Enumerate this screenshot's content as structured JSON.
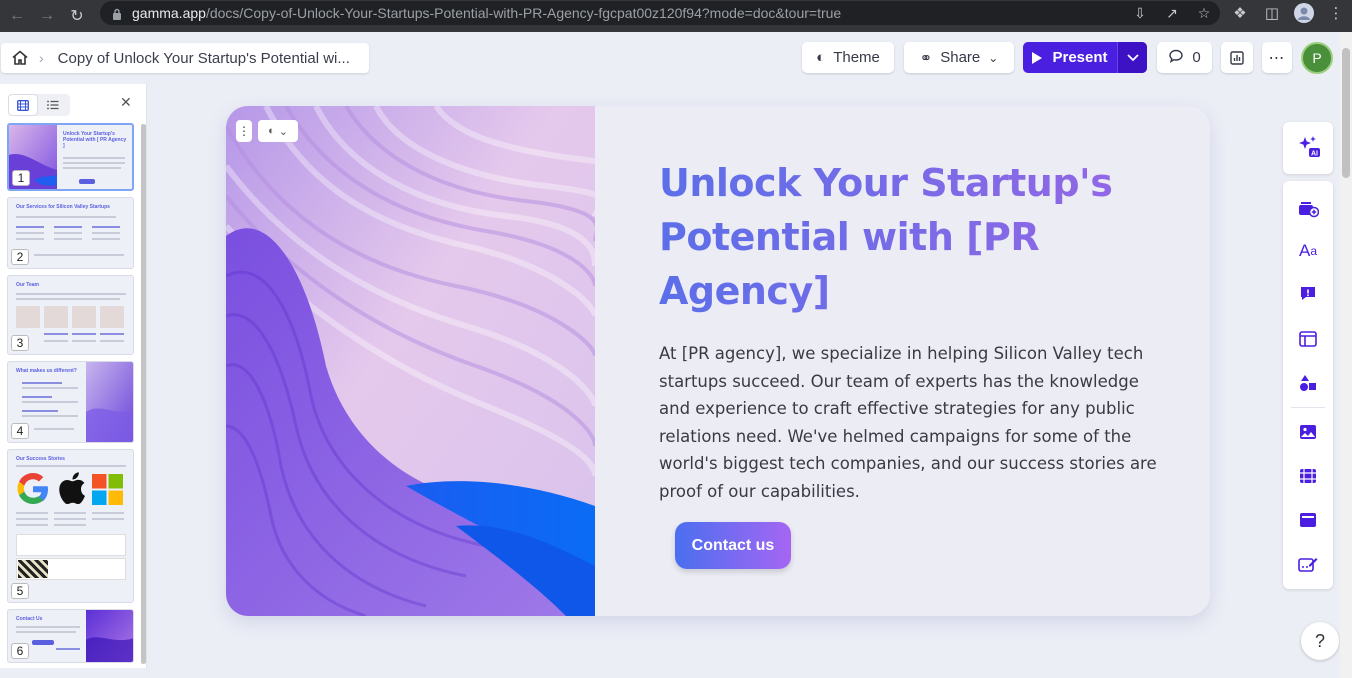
{
  "browser": {
    "url_domain": "gamma.app",
    "url_path": "/docs/Copy-of-Unlock-Your-Startups-Potential-with-PR-Agency-fgcpat00z120f94?mode=doc&tour=true"
  },
  "topbar": {
    "doc_title": "Copy of Unlock Your Startup's Potential wi...",
    "theme_label": "Theme",
    "share_label": "Share",
    "present_label": "Present",
    "comment_count": "0",
    "avatar_initial": "P"
  },
  "panel": {
    "thumbnails": [
      {
        "number": "1",
        "title": "Unlock Your Startup's Potential with [ PR Agency ]"
      },
      {
        "number": "2",
        "title": "Our Services for Silicon Valley Startups"
      },
      {
        "number": "3",
        "title": "Our Team"
      },
      {
        "number": "4",
        "title": "What makes us different?"
      },
      {
        "number": "5",
        "title": "Our Success Stories"
      },
      {
        "number": "6",
        "title": "Contact Us"
      }
    ]
  },
  "card": {
    "title": "Unlock Your Startup's Potential with [PR Agency]",
    "body": "At [PR agency], we specialize in helping Silicon Valley tech startups succeed. Our team of experts has the knowledge and experience to craft effective strategies for any public relations need. We've helmed campaigns for some of the world's biggest tech companies, and our success stories are proof of our capabilities.",
    "cta_label": "Contact us"
  },
  "help_label": "?",
  "colors": {
    "accent": "#4b1fe0",
    "title_gradient_start": "#5b6fe8",
    "title_gradient_end": "#9267e6",
    "cta_gradient_start": "#4b6ff0",
    "cta_gradient_end": "#a566f2"
  }
}
